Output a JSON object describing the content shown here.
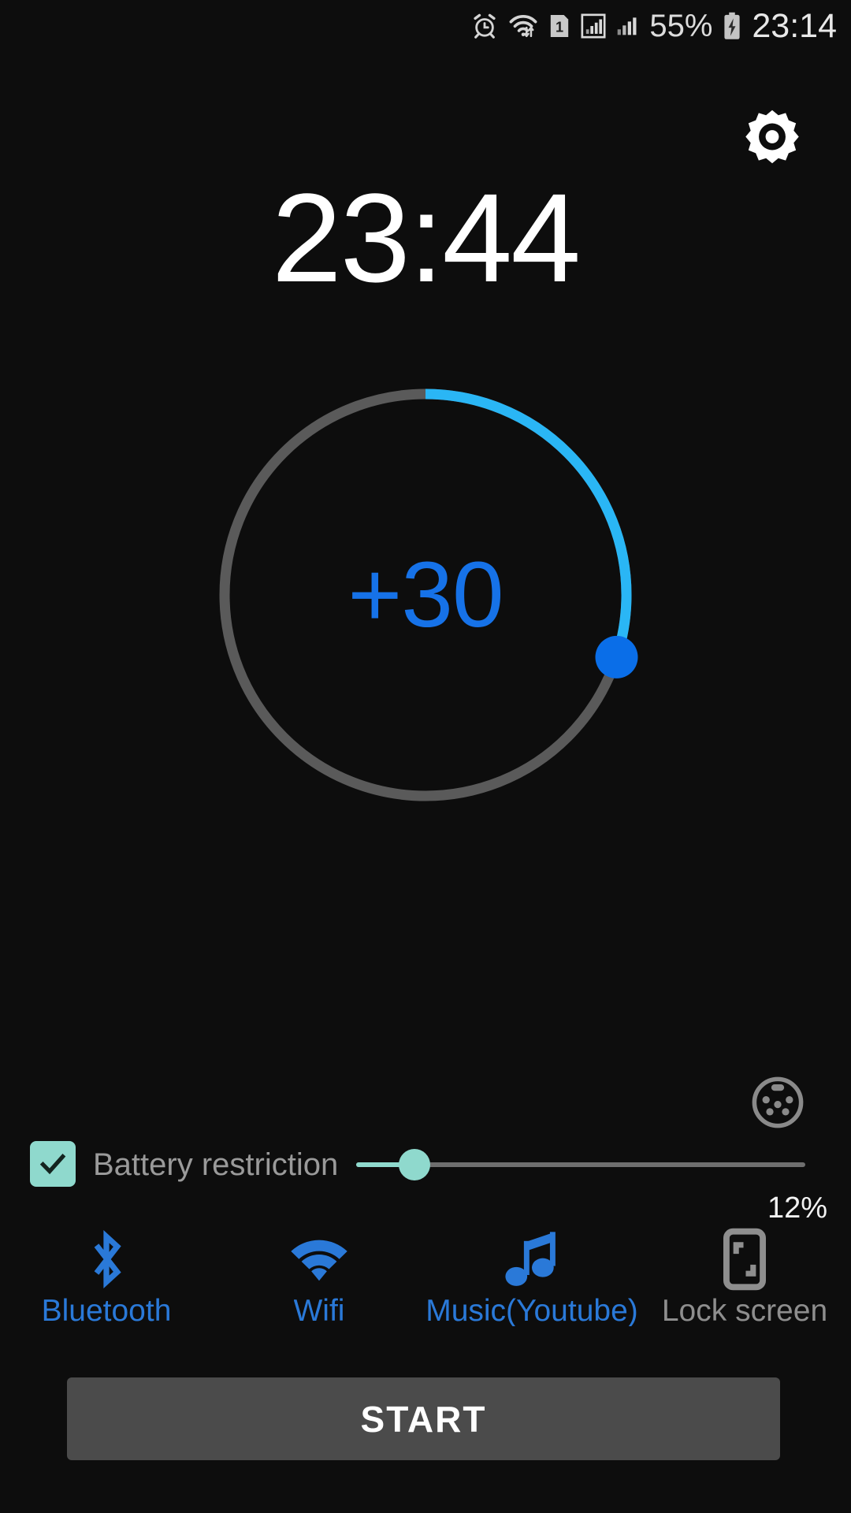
{
  "status_bar": {
    "icons": [
      "alarm-clock-icon",
      "wifi-transfer-icon",
      "sim-1-icon",
      "signal-boxed-icon",
      "signal-bars-icon"
    ],
    "sim_badge": "1",
    "battery_percent": "55%",
    "battery_icon": "battery-charging-icon",
    "clock": "23:14"
  },
  "header": {
    "settings_icon": "gear-icon"
  },
  "countdown": {
    "target_time": "23:44"
  },
  "dial": {
    "value_label": "+30",
    "progress_percent": 30,
    "track_color": "#5a5a5a",
    "progress_color": "#2ab6f5",
    "thumb_color": "#0a6ee8",
    "value_color": "#1672e8"
  },
  "connector": {
    "icon": "din-connector-icon"
  },
  "battery_restriction": {
    "checked": true,
    "label": "Battery restriction",
    "checkbox_color": "#8fd9cd",
    "slider": {
      "value_percent": 12,
      "value_label": "12%",
      "fill_color": "#8fd9cd",
      "track_color": "#6e6e6e"
    }
  },
  "toggles": [
    {
      "icon": "bluetooth-icon",
      "label": "Bluetooth",
      "state": "on",
      "color": "#2a79d8"
    },
    {
      "icon": "wifi-icon",
      "label": "Wifi",
      "state": "on",
      "color": "#2a79d8"
    },
    {
      "icon": "music-note-icon",
      "label": "Music(Youtube)",
      "state": "on",
      "color": "#2a79d8"
    },
    {
      "icon": "lock-screen-icon",
      "label": "Lock screen",
      "state": "off",
      "color": "#8e8e8e"
    }
  ],
  "actions": {
    "start_label": "START"
  }
}
